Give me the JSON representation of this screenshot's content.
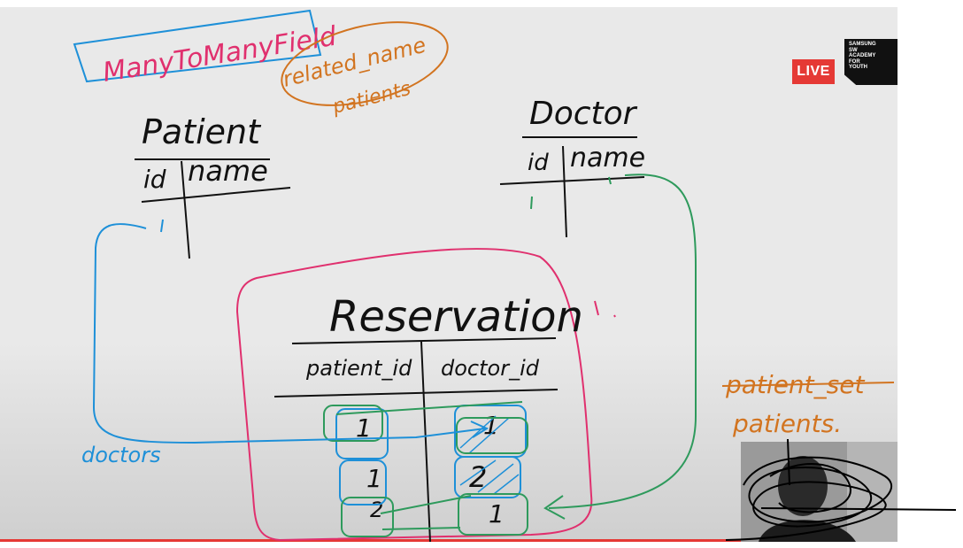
{
  "live_badge": "LIVE",
  "logo": {
    "lines": [
      "SAMSUNG",
      "SW",
      "ACADEMY",
      "FOR",
      "YOUTH"
    ]
  },
  "whiteboard": {
    "title": "ManyToManyField",
    "related_name": "related_name",
    "related_name_value": "patients",
    "patient_table": {
      "name": "Patient",
      "col1": "id",
      "col2": "name"
    },
    "doctor_table": {
      "name": "Doctor",
      "col1": "id",
      "col2": "name"
    },
    "reservation_table": {
      "name": "Reservation",
      "col1": "patient_id",
      "col2": "doctor_id",
      "rows": [
        [
          "1",
          "1"
        ],
        [
          "1",
          "2"
        ],
        [
          "2",
          "1"
        ]
      ]
    },
    "note_doctors": "doctors",
    "note_patient_set": "patient_set",
    "note_patients": "patients."
  },
  "colors": {
    "blue": "#1e90d8",
    "magenta": "#e0306e",
    "orange": "#d27420",
    "green": "#2e9a5c",
    "ink": "#111111",
    "live": "#e53935"
  },
  "progress_fraction": 1.0
}
